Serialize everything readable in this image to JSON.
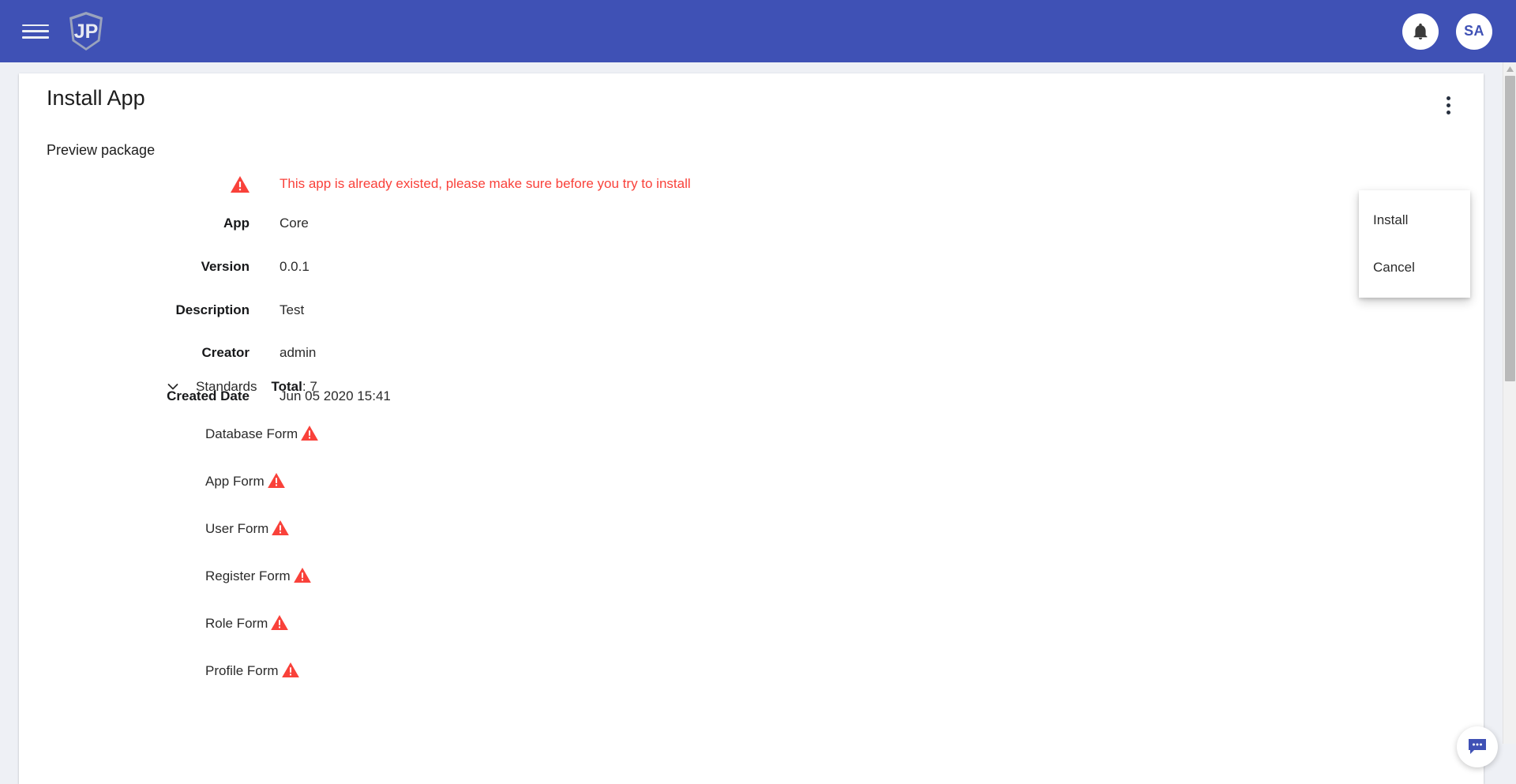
{
  "appbar": {
    "menu_icon": "hamburger-icon",
    "logo_text": "JP",
    "notification_icon": "bell-icon",
    "avatar_initials": "SA",
    "background_color": "#3f51b5"
  },
  "card": {
    "title": "Install App",
    "kebab_icon": "more-vertical-icon",
    "section_label": "Preview package"
  },
  "alert": {
    "icon": "warning-triangle-icon",
    "message": "This app is already existed, please make sure before you try to install",
    "color": "#f9413a"
  },
  "fields": [
    {
      "label": "App",
      "value": "Core"
    },
    {
      "label": "Version",
      "value": "0.0.1"
    },
    {
      "label": "Description",
      "value": "Test"
    },
    {
      "label": "Creator",
      "value": "admin"
    },
    {
      "label": "Created Date",
      "value": "Jun 05 2020 15:41"
    }
  ],
  "standards": {
    "chevron_icon": "chevron-down-icon",
    "title": "Standards",
    "total_label": "Total",
    "total_separator": ": ",
    "total_value": "7",
    "items": [
      {
        "name": "Database Form",
        "status_icon": "warning-triangle-icon"
      },
      {
        "name": "App Form",
        "status_icon": "warning-triangle-icon"
      },
      {
        "name": "User Form",
        "status_icon": "warning-triangle-icon"
      },
      {
        "name": "Register Form",
        "status_icon": "warning-triangle-icon"
      },
      {
        "name": "Role Form",
        "status_icon": "warning-triangle-icon"
      },
      {
        "name": "Profile Form",
        "status_icon": "warning-triangle-icon"
      }
    ]
  },
  "menu": {
    "items": [
      {
        "label": "Install"
      },
      {
        "label": "Cancel"
      }
    ]
  },
  "chat": {
    "icon": "chat-bubble-icon"
  },
  "scrollbar": {
    "up_arrow_icon": "scroll-up-arrow-icon"
  }
}
